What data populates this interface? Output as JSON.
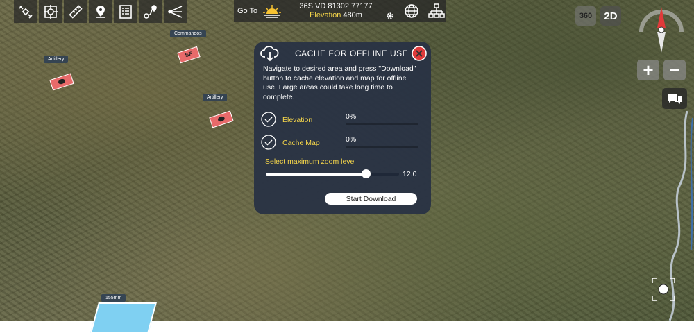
{
  "toolbar": {
    "icons": [
      "satellite-icon",
      "target-icon",
      "ruler-icon",
      "map-pin-icon",
      "list-icon",
      "route-icon",
      "sight-line-icon"
    ]
  },
  "topbar": {
    "goto_label": "Go To",
    "mgrs": "36S VD 81302 77177",
    "elevation_label": "Elevation",
    "elevation_value": "480m"
  },
  "view": {
    "btn_360": "360",
    "btn_2d": "2D",
    "zoom_in": "+",
    "zoom_out": "−"
  },
  "map_labels": {
    "artillery_1": "Artillery",
    "commandos": "Commandos",
    "artillery_2": "Artillery",
    "unit_155mm": "155mm",
    "sf_unit": "SF"
  },
  "dialog": {
    "title": "CACHE FOR OFFLINE USE",
    "description": "Navigate to desired area and press \"Download\" button to cache elevation and map for offline use. Large areas could take long time to complete.",
    "rows": [
      {
        "label": "Elevation",
        "percent": "0%",
        "progress": 0
      },
      {
        "label": "Cache Map",
        "percent": "0%",
        "progress": 0
      }
    ],
    "zoom_label": "Select maximum zoom level",
    "zoom_value": "12.0",
    "zoom_fraction": 0.75,
    "start_button": "Start Download"
  },
  "colors": {
    "accent_yellow": "#f6d64a",
    "dialog_bg": "#28324499",
    "close_red": "#e03a3a",
    "unit_red": "#e86a6a",
    "unit_blue": "#7fd0f2"
  }
}
